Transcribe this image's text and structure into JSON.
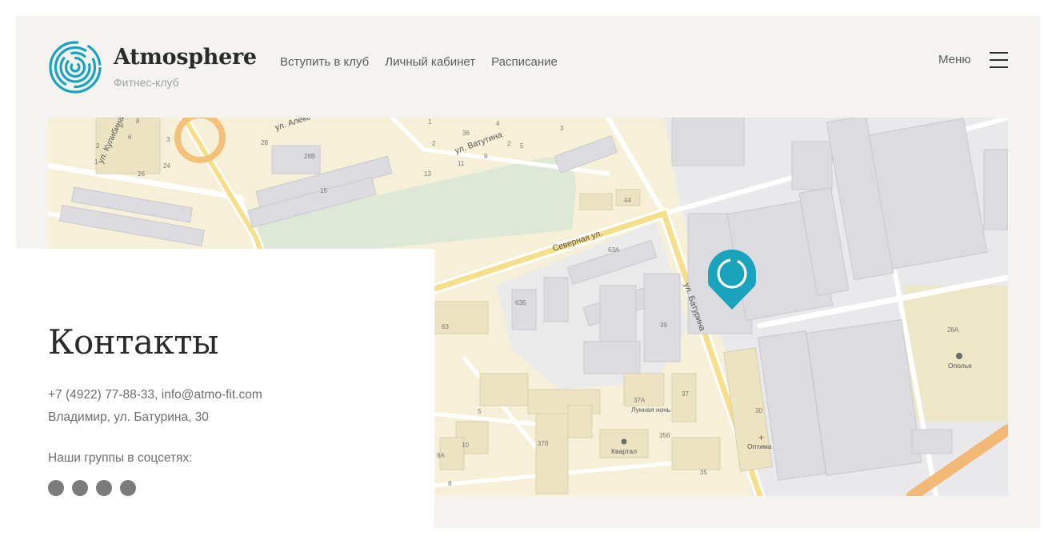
{
  "header": {
    "brand": "Atmosphere",
    "tagline": "Фитнес-клуб",
    "nav": [
      "Вступить в клуб",
      "Личный кабинет",
      "Расписание"
    ],
    "menu_label": "Меню"
  },
  "contacts": {
    "title": "Контакты",
    "phone": "+7 (4922) 77-88-33,",
    "email": "info@atmo-fit.com",
    "address": "Владимир, ул. Батурина, 30",
    "social_label": "Наши группы в соцсетях:",
    "social_icons": [
      "social-icon-1",
      "social-icon-2",
      "social-icon-3",
      "social-icon-4"
    ]
  },
  "map": {
    "streets": [
      "ул. Алекс",
      "ул. Ватутина",
      "ул. Кулибина",
      "Северная ул.",
      "ул. Батурина"
    ],
    "house_numbers": [
      "8",
      "6",
      "4",
      "3",
      "2",
      "1",
      "2",
      "1",
      "26",
      "24",
      "28",
      "28В",
      "15",
      "36",
      "4",
      "2",
      "3",
      "5",
      "11",
      "9",
      "13",
      "44",
      "63А",
      "63Б",
      "63",
      "39",
      "37А",
      "37",
      "35б",
      "37б",
      "5",
      "10",
      "8А",
      "8",
      "30",
      "35",
      "28А"
    ],
    "places": [
      "Лунная ночь",
      "Квартал",
      "Оптима",
      "Ополье"
    ],
    "accent_color": "#1aa3bd"
  }
}
